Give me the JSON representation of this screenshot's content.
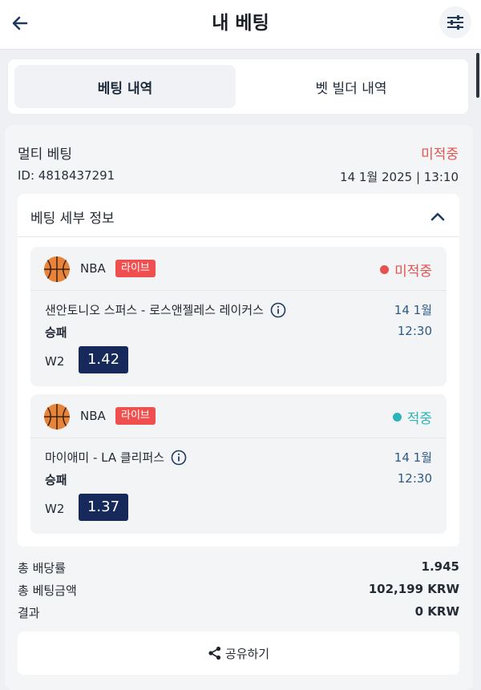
{
  "header": {
    "title": "내 베팅",
    "back_icon": "arrow-left-icon",
    "filter_icon": "sliders-icon"
  },
  "tabs": [
    {
      "label": "베팅 내역",
      "active": true
    },
    {
      "label": "벳 빌더 내역",
      "active": false
    }
  ],
  "bet": {
    "type": "멀티 베팅",
    "status": "미적중",
    "id": "ID: 4818437291",
    "date": "14 1월 2025 | 13:10",
    "details_title": "베팅 세부 정보",
    "events": [
      {
        "league": "NBA",
        "badge": "라이브",
        "status": "미적중",
        "status_color": "#e5524f",
        "match": "샌안토니오 스퍼스 - 로스앤젤레스 레이커스",
        "date": "14 1월",
        "time": "12:30",
        "market": "승패",
        "outcome": "W2",
        "odds": "1.42"
      },
      {
        "league": "NBA",
        "badge": "라이브",
        "status": "적중",
        "status_color": "#2bb5b8",
        "match": "마이애미 - LA 클리퍼스",
        "date": "14 1월",
        "time": "12:30",
        "market": "승패",
        "outcome": "W2",
        "odds": "1.37"
      }
    ],
    "summary": {
      "total_odds_label": "총 배당률",
      "total_odds": "1.945",
      "stake_label": "총 베팅금액",
      "stake": "102,199 KRW",
      "result_label": "결과",
      "result": "0 KRW"
    },
    "share_label": "공유하기"
  },
  "colors": {
    "lost": "#e5524f",
    "won": "#2bb5b8",
    "odds_bg": "#17295a",
    "badge_bg": "#ef4f4f",
    "date_blue": "#2e5b86"
  }
}
